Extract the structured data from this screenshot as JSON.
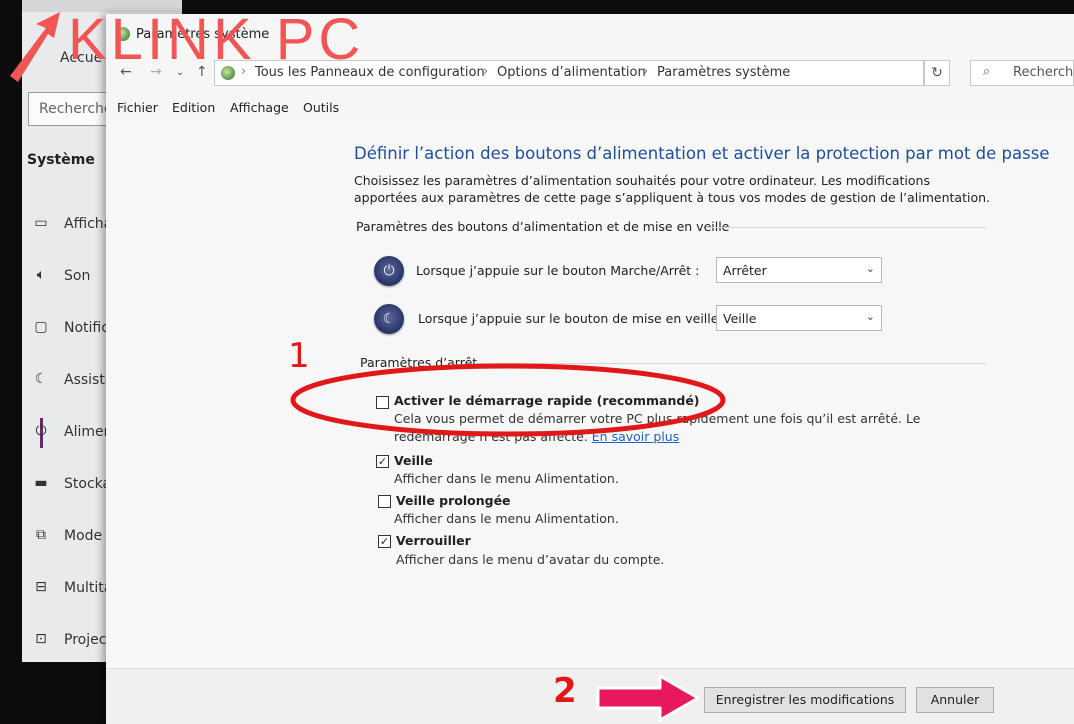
{
  "background_window": {
    "home_label": "Accue",
    "search_placeholder": "Recherche",
    "section_title": "Système",
    "items": [
      {
        "icon": "display-icon",
        "label": "Afficha"
      },
      {
        "icon": "sound-icon",
        "label": "Son"
      },
      {
        "icon": "notifications-icon",
        "label": "Notifica"
      },
      {
        "icon": "focus-assist-icon",
        "label": "Assista"
      },
      {
        "icon": "power-icon",
        "label": "Alimen"
      },
      {
        "icon": "storage-icon",
        "label": "Stockag"
      },
      {
        "icon": "tablet-mode-icon",
        "label": "Mode t"
      },
      {
        "icon": "multitasking-icon",
        "label": "Multitâ"
      },
      {
        "icon": "projection-icon",
        "label": "Projecti"
      }
    ]
  },
  "window": {
    "title": "Paramètres système",
    "breadcrumb": [
      "Tous les Panneaux de configuration",
      "Options d’alimentation",
      "Paramètres système"
    ],
    "search_placeholder": "Recherche",
    "menu": [
      "Fichier",
      "Edition",
      "Affichage",
      "Outils"
    ]
  },
  "content": {
    "heading": "Définir l’action des boutons d’alimentation et activer la protection par mot de passe",
    "description": "Choisissez les paramètres d’alimentation souhaités pour votre ordinateur. Les modifications apportées aux paramètres de cette page s’appliquent à tous vos modes de gestion de l’alimentation.",
    "buttons_section_title": "Paramètres des boutons d’alimentation et de mise en veille",
    "power_button_label": "Lorsque j’appuie sur le bouton Marche/Arrêt :",
    "power_button_value": "Arrêter",
    "sleep_button_label": "Lorsque j’appuie sur le bouton de mise en veille :",
    "sleep_button_value": "Veille",
    "shutdown_section_title": "Paramètres d’arrêt",
    "fast_startup": {
      "label": "Activer le démarrage rapide (recommandé)",
      "checked": false,
      "description": "Cela vous permet de démarrer votre PC plus rapidement une fois qu’il est arrêté. Le redémarrage n’est pas affecté.",
      "link": "En savoir plus"
    },
    "options": [
      {
        "label": "Veille",
        "checked": true,
        "description": "Afficher dans le menu Alimentation."
      },
      {
        "label": "Veille prolongée",
        "checked": false,
        "description": "Afficher dans le menu Alimentation."
      },
      {
        "label": "Verrouiller",
        "checked": true,
        "description": "Afficher dans le menu d’avatar du compte."
      }
    ]
  },
  "footer": {
    "save_label": "Enregistrer les modifications",
    "cancel_label": "Annuler"
  },
  "overlay": {
    "watermark": "KLINK PC",
    "step1": "1",
    "step2": "2",
    "accent_color": "#e8185e",
    "circle_color": "#e01818"
  }
}
